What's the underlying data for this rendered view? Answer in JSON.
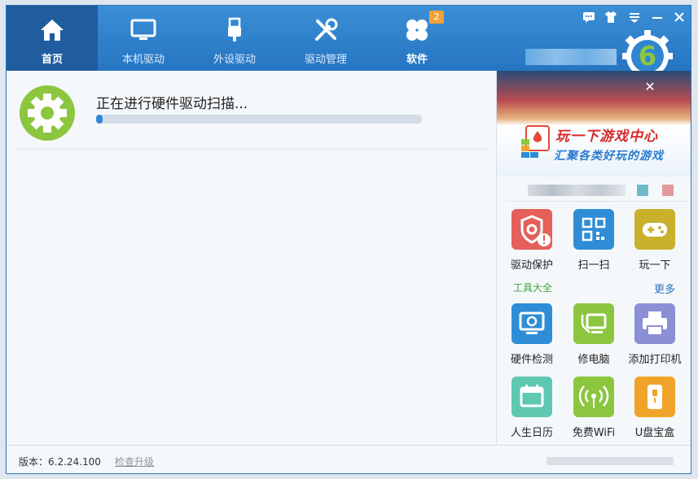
{
  "nav": {
    "tabs": [
      {
        "label": "首页",
        "icon": "home-icon"
      },
      {
        "label": "本机驱动",
        "icon": "monitor-icon"
      },
      {
        "label": "外设驱动",
        "icon": "usb-icon"
      },
      {
        "label": "驱动管理",
        "icon": "tools-icon"
      },
      {
        "label": "软件",
        "icon": "clover-icon"
      }
    ],
    "software_badge": "2",
    "logo_text": "6"
  },
  "window_controls": [
    "message-icon",
    "skin-icon",
    "menu-icon",
    "minimize-icon",
    "close-icon"
  ],
  "scan": {
    "status": "正在进行硬件驱动扫描...",
    "progress": 0.02
  },
  "banner": {
    "title": "玩一下游戏中心",
    "subtitle": "汇聚各类好玩的游戏",
    "close": "✕"
  },
  "quick_tools": [
    {
      "label": "驱动保护",
      "color": "#e5605a"
    },
    {
      "label": "扫一扫",
      "color": "#2e8dd6"
    },
    {
      "label": "玩一下",
      "color": "#c9b12c"
    }
  ],
  "toolbox": {
    "title": "工具大全",
    "more": "更多",
    "items": [
      {
        "label": "硬件检测",
        "color": "#2e8dd6"
      },
      {
        "label": "修电脑",
        "color": "#8cc63f"
      },
      {
        "label": "添加打印机",
        "color": "#8a8fd6"
      },
      {
        "label": "人生日历",
        "color": "#5fc8b0"
      },
      {
        "label": "免费WiFi",
        "color": "#8cc63f"
      },
      {
        "label": "U盘宝盒",
        "color": "#f0a32a"
      }
    ]
  },
  "footer": {
    "version": "版本：6.2.24.100",
    "check_update": "检查升级"
  },
  "colors": {
    "header": "#2675c2",
    "active_tab": "#1f5d9e",
    "accent_green": "#8cc63f"
  }
}
